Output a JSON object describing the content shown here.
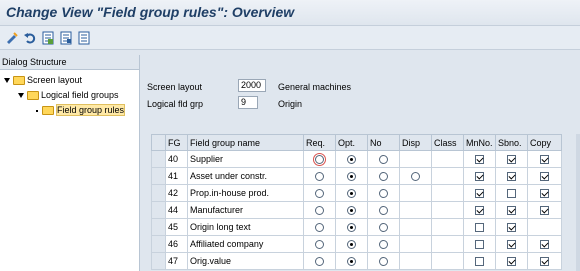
{
  "window": {
    "title": "Change View \"Field group rules\": Overview"
  },
  "toolbar": {
    "icons": [
      "display-change-icon",
      "undo-icon",
      "save-entries-icon",
      "select-all-icon",
      "deselect-icon"
    ]
  },
  "dialog_structure": {
    "header": "Dialog Structure",
    "items": [
      {
        "label": "Screen layout",
        "level": 0,
        "expanded": true
      },
      {
        "label": "Logical field groups",
        "level": 1,
        "expanded": true
      },
      {
        "label": "Field group rules",
        "level": 2,
        "selected": true
      }
    ]
  },
  "header_fields": {
    "screen_layout": {
      "label": "Screen layout",
      "value": "2000",
      "text": "General machines"
    },
    "logical_fld_grp": {
      "label": "Logical fld grp",
      "value": "9",
      "text": "Origin"
    }
  },
  "table": {
    "columns": [
      "FG",
      "Field group name",
      "Req.",
      "Opt.",
      "No",
      "Disp",
      "Class",
      "MnNo.",
      "Sbno.",
      "Copy"
    ],
    "rows": [
      {
        "fg": "40",
        "name": "Supplier",
        "choice": "Opt.",
        "req_focus": true,
        "disp_radio": false,
        "mnno": true,
        "sbno": true,
        "copy": true
      },
      {
        "fg": "41",
        "name": "Asset under constr.",
        "choice": "Opt.",
        "req_focus": false,
        "disp_radio": true,
        "mnno": true,
        "sbno": true,
        "copy": true
      },
      {
        "fg": "42",
        "name": "Prop.in-house prod.",
        "choice": "Opt.",
        "req_focus": false,
        "disp_radio": false,
        "mnno": true,
        "sbno": false,
        "copy": true
      },
      {
        "fg": "44",
        "name": "Manufacturer",
        "choice": "Opt.",
        "req_focus": false,
        "disp_radio": false,
        "mnno": true,
        "sbno": true,
        "copy": true
      },
      {
        "fg": "45",
        "name": "Origin long text",
        "choice": "Opt.",
        "req_focus": false,
        "disp_radio": false,
        "mnno": false,
        "sbno": true,
        "copy": null
      },
      {
        "fg": "46",
        "name": "Affiliated company",
        "choice": "Opt.",
        "req_focus": false,
        "disp_radio": false,
        "mnno": false,
        "sbno": true,
        "copy": true
      },
      {
        "fg": "47",
        "name": "Orig.value",
        "choice": "Opt.",
        "req_focus": false,
        "disp_radio": false,
        "mnno": false,
        "sbno": true,
        "copy": true
      }
    ]
  }
}
